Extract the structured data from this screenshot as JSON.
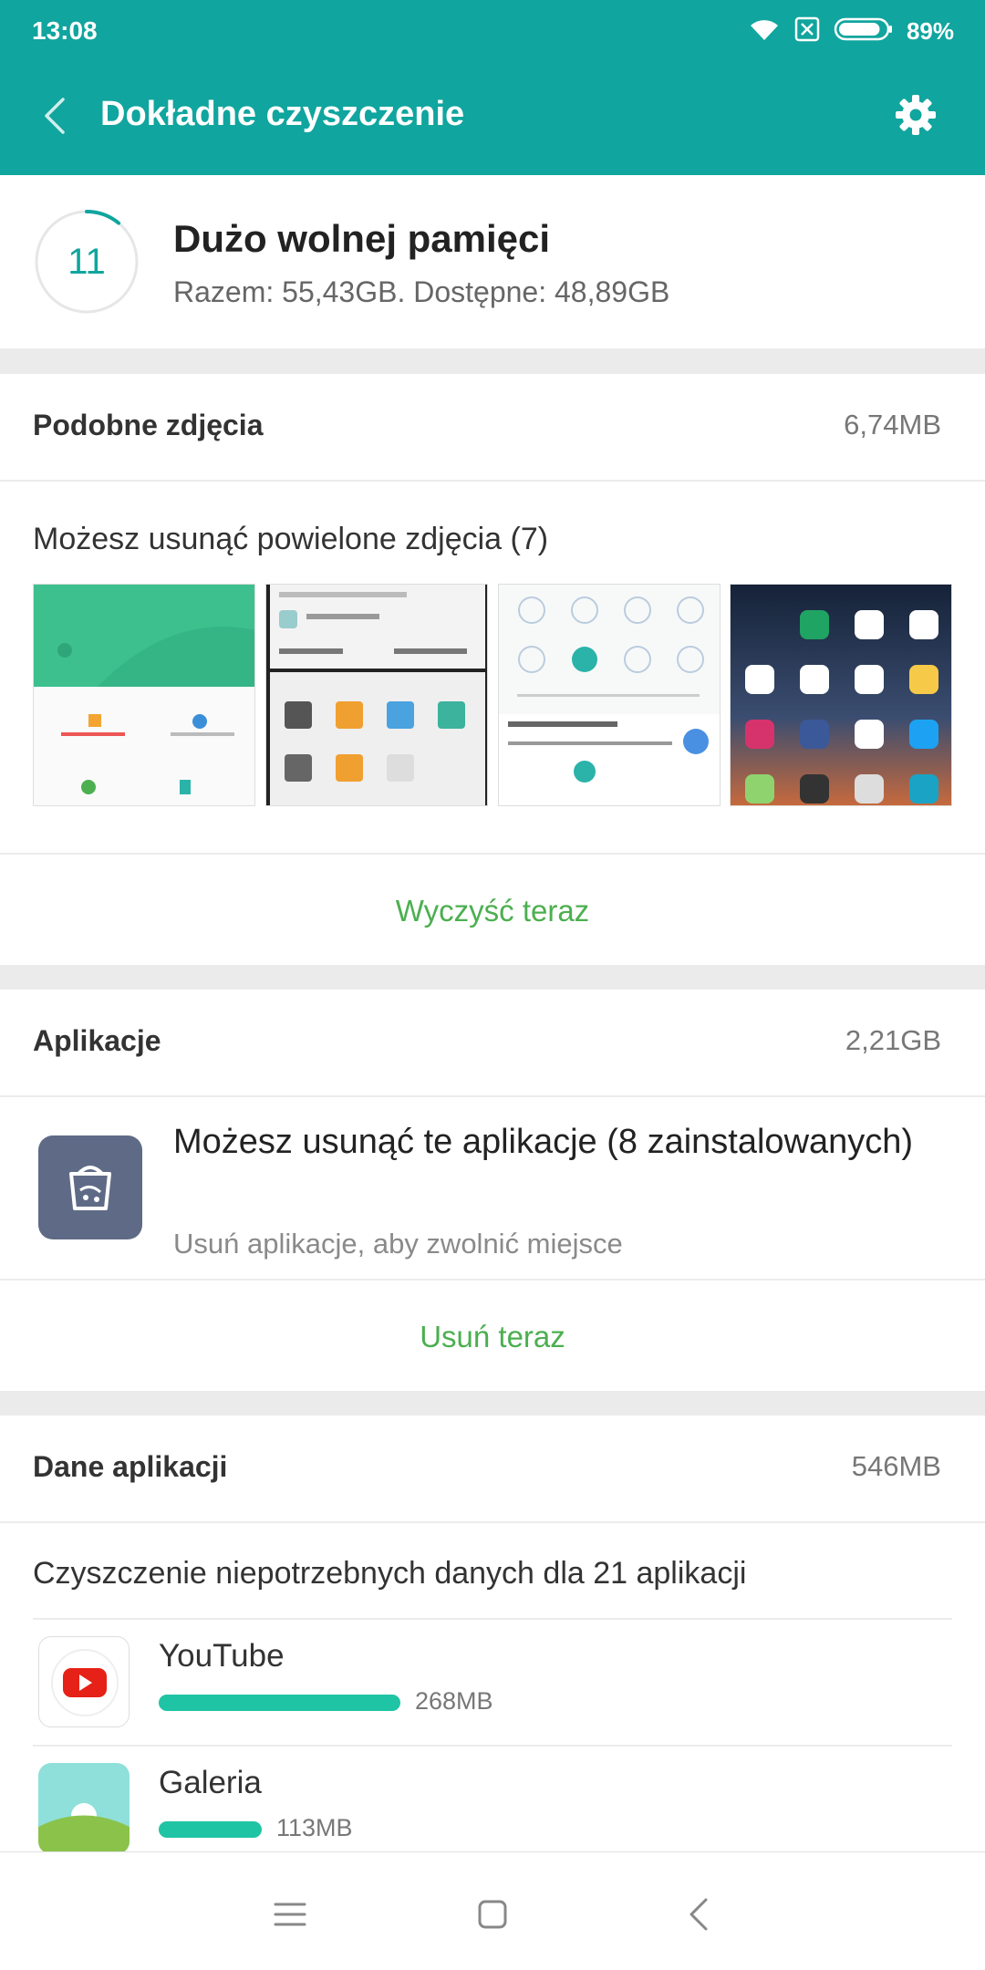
{
  "status": {
    "time": "13:08",
    "battery": "89%",
    "battery_level": 0.89,
    "icons": [
      "wifi-icon",
      "no-sim-icon",
      "battery-icon"
    ]
  },
  "header": {
    "title": "Dokładne czyszczenie",
    "back_icon": "chevron-left-icon",
    "settings_icon": "gear-icon"
  },
  "storage": {
    "ring_value": "11",
    "ring_fraction": 0.11,
    "title": "Dużo wolnej pamięci",
    "subtitle": "Razem: 55,43GB. Dostępne: 48,89GB"
  },
  "similar_photos": {
    "title": "Podobne zdjęcia",
    "size": "6,74MB",
    "description": "Możesz usunąć powielone zdjęcia (7)",
    "action": "Wyczyść teraz",
    "thumbnails": [
      "thumb-1",
      "thumb-2",
      "thumb-3",
      "thumb-4"
    ]
  },
  "apps": {
    "title": "Aplikacje",
    "size": "2,21GB",
    "headline": "Możesz usunąć te aplikacje (8 zainstalowanych)",
    "sub": "Usuń aplikacje, aby zwolnić miejsce",
    "action": "Usuń teraz"
  },
  "app_data": {
    "title": "Dane aplikacji",
    "size": "546MB",
    "description": "Czyszczenie niepotrzebnych danych dla 21 aplikacji",
    "items": [
      {
        "name": "YouTube",
        "size": "268MB",
        "fraction": 0.49
      },
      {
        "name": "Galeria",
        "size": "113MB",
        "fraction": 0.21
      }
    ]
  },
  "colors": {
    "accent": "#10a59e",
    "action_green": "#4caf50",
    "bar": "#1fc4a4",
    "trash_tile": "#5f6b86"
  },
  "navbar": {
    "icons": [
      "menu-icon",
      "home-square-icon",
      "back-triangle-icon"
    ]
  }
}
